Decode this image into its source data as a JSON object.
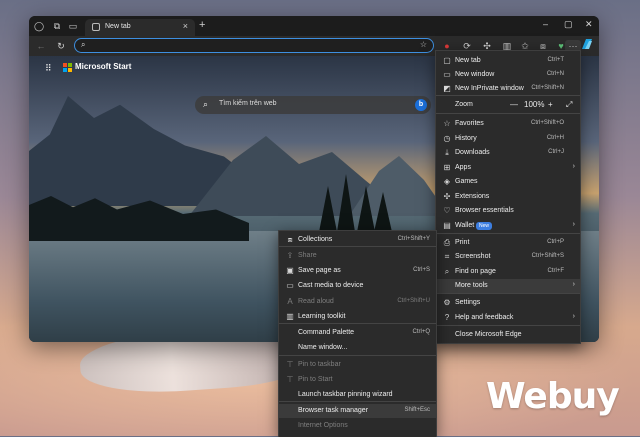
{
  "tab": {
    "label": "New tab"
  },
  "page": {
    "brand": "Microsoft Start",
    "search_placeholder": "Tìm kiếm trên web",
    "bing": "b"
  },
  "main_menu": [
    {
      "label": "New tab",
      "shortcut": "Ctrl+T",
      "icon": "new-tab-icon"
    },
    {
      "label": "New window",
      "shortcut": "Ctrl+N",
      "icon": "new-window-icon"
    },
    {
      "label": "New InPrivate window",
      "shortcut": "Ctrl+Shift+N",
      "icon": "inprivate-icon"
    },
    {
      "label": "Zoom",
      "zoom_minus": "—",
      "zoom_value": "100%",
      "zoom_plus": "+",
      "fullscreen": "⤢",
      "type": "zoom"
    },
    {
      "label": "Favorites",
      "shortcut": "Ctrl+Shift+O",
      "icon": "favorites-icon"
    },
    {
      "label": "History",
      "shortcut": "Ctrl+H",
      "icon": "history-icon"
    },
    {
      "label": "Downloads",
      "shortcut": "Ctrl+J",
      "icon": "downloads-icon"
    },
    {
      "label": "Apps",
      "shortcut": "",
      "icon": "apps-icon",
      "arrow": "›"
    },
    {
      "label": "Games",
      "shortcut": "",
      "icon": "games-icon"
    },
    {
      "label": "Extensions",
      "shortcut": "",
      "icon": "extensions-icon"
    },
    {
      "label": "Browser essentials",
      "shortcut": "",
      "icon": "heart-pulse-icon"
    },
    {
      "label": "Wallet",
      "shortcut": "",
      "icon": "wallet-icon",
      "badge": "New",
      "arrow": "›"
    },
    {
      "label": "Print",
      "shortcut": "Ctrl+P",
      "icon": "print-icon"
    },
    {
      "label": "Screenshot",
      "shortcut": "Ctrl+Shift+S",
      "icon": "screenshot-icon"
    },
    {
      "label": "Find on page",
      "shortcut": "Ctrl+F",
      "icon": "find-icon"
    },
    {
      "label": "More tools",
      "shortcut": "",
      "icon": "",
      "arrow": "›",
      "hover": true
    },
    {
      "label": "Settings",
      "shortcut": "",
      "icon": "settings-icon"
    },
    {
      "label": "Help and feedback",
      "shortcut": "",
      "icon": "help-icon",
      "arrow": "›"
    },
    {
      "label": "Close Microsoft Edge",
      "shortcut": "",
      "icon": ""
    }
  ],
  "sub_menu": [
    {
      "label": "Collections",
      "shortcut": "Ctrl+Shift+Y",
      "icon": "collections-icon",
      "disabled": false
    },
    {
      "label": "Share",
      "shortcut": "",
      "icon": "share-icon",
      "disabled": true
    },
    {
      "label": "Save page as",
      "shortcut": "Ctrl+S",
      "icon": "save-icon",
      "disabled": false
    },
    {
      "label": "Cast media to device",
      "shortcut": "",
      "icon": "cast-icon",
      "disabled": false
    },
    {
      "label": "Read aloud",
      "shortcut": "Ctrl+Shift+U",
      "icon": "read-aloud-icon",
      "disabled": true
    },
    {
      "label": "Learning toolkit",
      "shortcut": "",
      "icon": "learning-icon",
      "disabled": false
    },
    {
      "label": "Command Palette",
      "shortcut": "Ctrl+Q",
      "icon": "",
      "disabled": false
    },
    {
      "label": "Name window...",
      "shortcut": "",
      "icon": "",
      "disabled": false
    },
    {
      "label": "Pin to taskbar",
      "shortcut": "",
      "icon": "pin-icon",
      "disabled": true
    },
    {
      "label": "Pin to Start",
      "shortcut": "",
      "icon": "pin-icon",
      "disabled": true
    },
    {
      "label": "Launch taskbar pinning wizard",
      "shortcut": "",
      "icon": "",
      "disabled": false
    },
    {
      "label": "Browser task manager",
      "shortcut": "Shift+Esc",
      "icon": "",
      "disabled": false,
      "hover": true
    },
    {
      "label": "Internet Options",
      "shortcut": "",
      "icon": "",
      "disabled": true
    }
  ],
  "watermark": "Webuy",
  "colors": {
    "accent": "#3d8fe0",
    "menu_bg": "#2b2b2b",
    "hover": "#3b3b3b"
  }
}
